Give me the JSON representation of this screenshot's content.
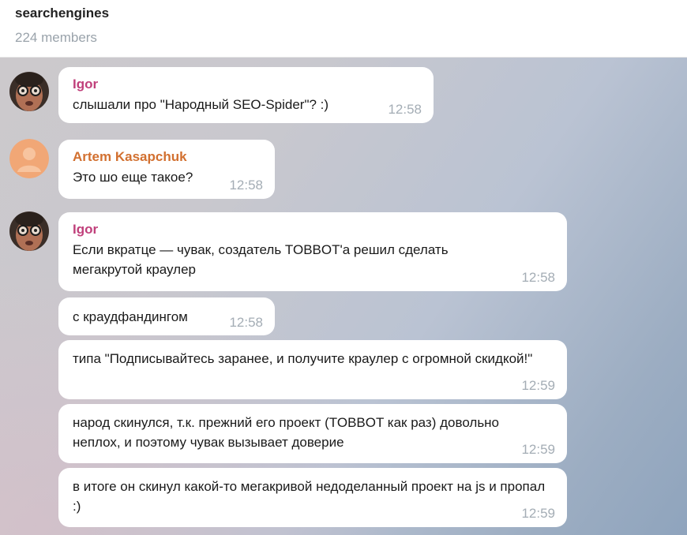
{
  "header": {
    "title": "searchengines",
    "subtitle": "224 members"
  },
  "messages": [
    {
      "sender": "Igor",
      "text": "слышали про \"Народный SEO-Spider\"? :)",
      "time": "12:58"
    },
    {
      "sender": "Artem Kasapchuk",
      "text": "Это шо еще такое?",
      "time": "12:58"
    },
    {
      "sender": "Igor",
      "text": "Если вкратце — чувак, создатель TOBBOT'а решил сделать мегакрутой краулер",
      "time": "12:58"
    },
    {
      "sender": "",
      "text": "с краудфандингом",
      "time": "12:58"
    },
    {
      "sender": "",
      "text": "типа \"Подписывайтесь заранее, и получите краулер с огромной скидкой!\"",
      "time": "12:59"
    },
    {
      "sender": "",
      "text": "народ скинулся, т.к. прежний его проект (TOBBOT как раз) довольно неплох, и поэтому чувак вызывает доверие",
      "time": "12:59"
    },
    {
      "sender": "",
      "text": "в итоге он скинул какой-то мегакривой недоделанный проект на js и пропал :)",
      "time": "12:59"
    }
  ],
  "colors": {
    "igor_name": "#c0407b",
    "artem_name": "#d27030",
    "time": "#a4adb5"
  },
  "icons": {
    "igor_avatar": "avatar-photo-glasses",
    "artem_avatar": "avatar-placeholder-person"
  }
}
